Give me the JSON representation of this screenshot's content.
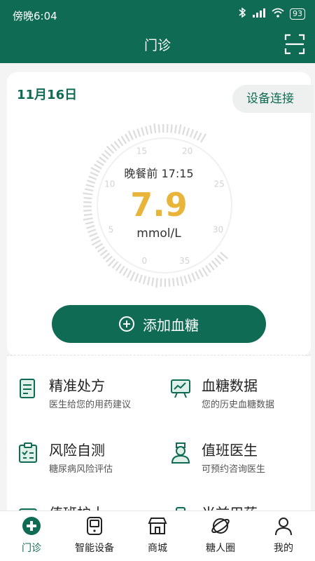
{
  "status_bar": {
    "time": "傍晚6:04",
    "battery": "93"
  },
  "header": {
    "title": "门诊"
  },
  "glucose_card": {
    "date": "11月16日",
    "device_connect_label": "设备连接",
    "reading_label": "晚餐前 17:15",
    "value": "7.9",
    "unit": "mmol/L",
    "value_color": "#e8b53a",
    "gauge_ticks": [
      "0",
      "5",
      "10",
      "15",
      "20",
      "25",
      "30",
      "35"
    ],
    "add_button_label": "添加血糖"
  },
  "services": [
    {
      "title": "精准处方",
      "subtitle": "医生给您的用药建议",
      "icon": "prescription-icon"
    },
    {
      "title": "血糖数据",
      "subtitle": "您的历史血糖数据",
      "icon": "chart-board-icon"
    },
    {
      "title": "风险自测",
      "subtitle": "糖尿病风险评估",
      "icon": "checklist-icon"
    },
    {
      "title": "值班医生",
      "subtitle": "可预约咨询医生",
      "icon": "doctor-icon"
    },
    {
      "title": "值班护士",
      "subtitle": "",
      "icon": "nurse-icon"
    },
    {
      "title": "当前用药",
      "subtitle": "",
      "icon": "medicine-icon"
    }
  ],
  "tabbar": {
    "items": [
      {
        "label": "门诊",
        "icon": "clinic-icon",
        "active": true
      },
      {
        "label": "智能设备",
        "icon": "device-icon",
        "active": false
      },
      {
        "label": "商城",
        "icon": "shop-icon",
        "active": false
      },
      {
        "label": "糖人圈",
        "icon": "planet-icon",
        "active": false
      },
      {
        "label": "我的",
        "icon": "user-icon",
        "active": false
      }
    ]
  },
  "colors": {
    "primary": "#0f6b53",
    "accent": "#e8b53a"
  }
}
